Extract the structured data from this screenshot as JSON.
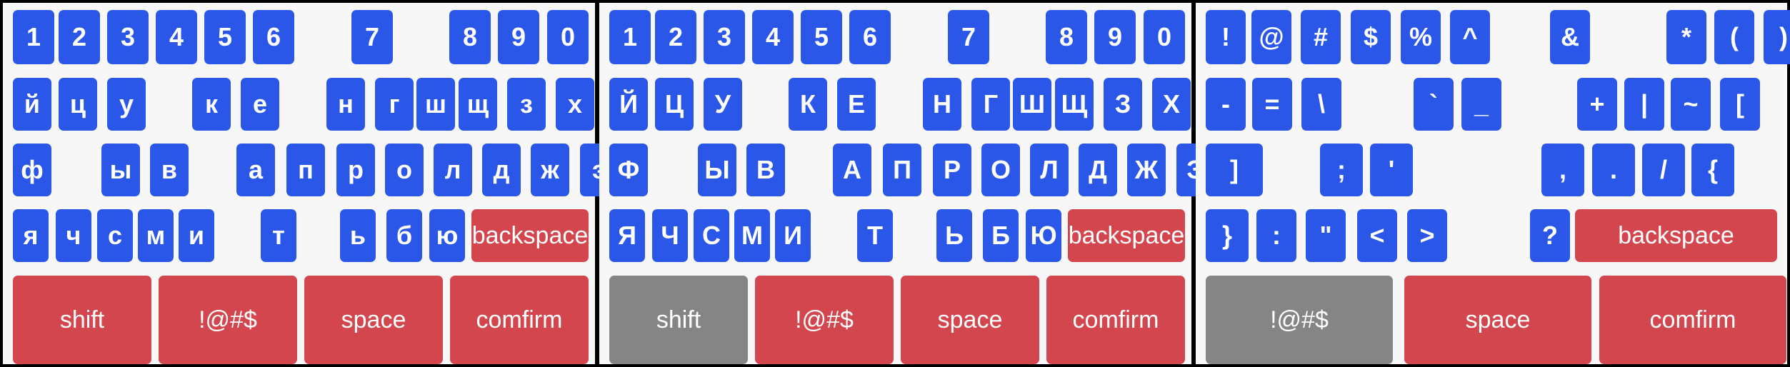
{
  "colors": {
    "key_blue": "#2b57e8",
    "key_red": "#d4464d",
    "key_gray": "#858585",
    "panel_background": "#f7f7f7",
    "divider": "#000000"
  },
  "keyboards": [
    {
      "name": "cyrillic-lowercase",
      "rows": [
        [
          "1",
          "2",
          "3",
          "4",
          "5",
          "6",
          "7",
          "8",
          "9",
          "0"
        ],
        [
          "й",
          "ц",
          "у",
          "к",
          "е",
          "н",
          "г",
          "ш",
          "щ",
          "з",
          "х"
        ],
        [
          "ф",
          "ы",
          "в",
          "а",
          "п",
          "р",
          "о",
          "л",
          "д",
          "ж",
          "э"
        ],
        [
          "я",
          "ч",
          "с",
          "м",
          "и",
          "т",
          "ь",
          "б",
          "ю"
        ]
      ],
      "backspace_label": "backspace",
      "bottom_row": [
        "shift",
        "!@#$",
        "space",
        "comfirm"
      ]
    },
    {
      "name": "cyrillic-uppercase",
      "rows": [
        [
          "1",
          "2",
          "3",
          "4",
          "5",
          "6",
          "7",
          "8",
          "9",
          "0"
        ],
        [
          "Й",
          "Ц",
          "У",
          "К",
          "Е",
          "Н",
          "Г",
          "Ш",
          "Щ",
          "З",
          "Х"
        ],
        [
          "Ф",
          "Ы",
          "В",
          "А",
          "П",
          "Р",
          "О",
          "Л",
          "Д",
          "Ж",
          "Э"
        ],
        [
          "Я",
          "Ч",
          "С",
          "М",
          "И",
          "Т",
          "Ь",
          "Б",
          "Ю"
        ]
      ],
      "backspace_label": "backspace",
      "bottom_row": [
        "shift",
        "!@#$",
        "space",
        "comfirm"
      ],
      "active_key": "shift"
    },
    {
      "name": "symbols",
      "rows": [
        [
          "!",
          "@",
          "#",
          "$",
          "%",
          "^",
          "&",
          "*",
          "(",
          ")"
        ],
        [
          "-",
          "=",
          "\\",
          "`",
          "_",
          "+",
          "|",
          "~",
          "["
        ],
        [
          "]",
          ";",
          "'",
          ",",
          ".",
          "/",
          "{"
        ],
        [
          "}",
          ":",
          "\"",
          "<",
          ">",
          "?"
        ]
      ],
      "backspace_label": "backspace",
      "bottom_row": [
        "!@#$",
        "space",
        "comfirm"
      ],
      "active_key": "!@#$"
    }
  ]
}
